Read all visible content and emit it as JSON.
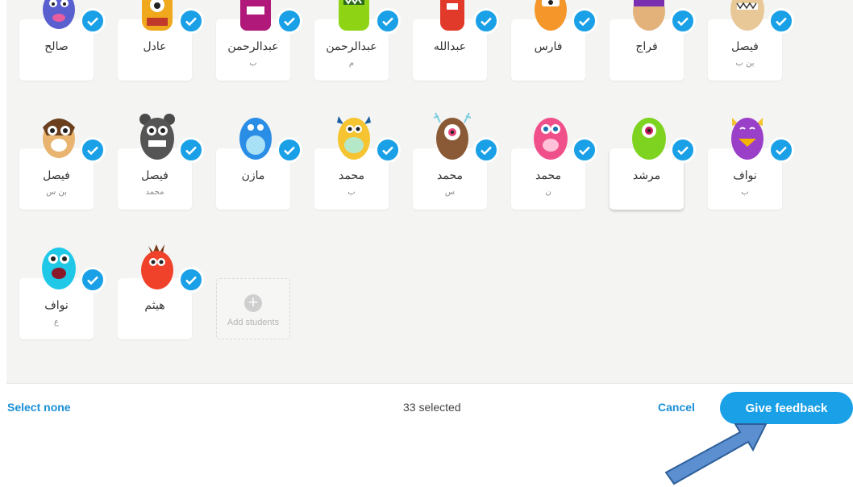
{
  "students": [
    {
      "name": "صالح",
      "sub": "",
      "monster": "m-blue-horns"
    },
    {
      "name": "عادل",
      "sub": "",
      "monster": "m-yellow-onion"
    },
    {
      "name": "عبدالرحمن",
      "sub": "ب",
      "monster": "m-magenta-fuzzy"
    },
    {
      "name": "عبدالرحمن",
      "sub": "م",
      "monster": "m-green-spiky"
    },
    {
      "name": "عبدالله",
      "sub": "",
      "monster": "m-red-tall"
    },
    {
      "name": "فارس",
      "sub": "",
      "monster": "m-orange-horns"
    },
    {
      "name": "فراج",
      "sub": "",
      "monster": "m-purple-hair"
    },
    {
      "name": "فيصل",
      "sub": "بن ب",
      "monster": "m-beige-furry"
    },
    {
      "name": "فيصل",
      "sub": "بن س",
      "monster": "m-hamster"
    },
    {
      "name": "فيصل",
      "sub": "محمد",
      "monster": "m-grey-bear"
    },
    {
      "name": "مازن",
      "sub": "",
      "monster": "m-blue-fuzzy"
    },
    {
      "name": "محمد",
      "sub": "ب",
      "monster": "m-yellow-horns"
    },
    {
      "name": "محمد",
      "sub": "س",
      "monster": "m-brown-cyclops"
    },
    {
      "name": "محمد",
      "sub": "ن",
      "monster": "m-pink-fuzzy"
    },
    {
      "name": "مرشد",
      "sub": "",
      "monster": "m-green-cyclops"
    },
    {
      "name": "نواف",
      "sub": "ب",
      "monster": "m-purple-duck"
    },
    {
      "name": "نواف",
      "sub": "ع",
      "monster": "m-cyan-fuzzy"
    },
    {
      "name": "هيثم",
      "sub": "",
      "monster": "m-red-blob"
    }
  ],
  "add_students_label": "Add students",
  "footer": {
    "select_none": "Select none",
    "selected_count": "33 selected",
    "cancel": "Cancel",
    "give_feedback": "Give feedback"
  },
  "colors": {
    "accent": "#1aa0e6",
    "link": "#1a8fd8",
    "arrow_fill": "#5b8fd0",
    "arrow_stroke": "#2f5f9a"
  }
}
